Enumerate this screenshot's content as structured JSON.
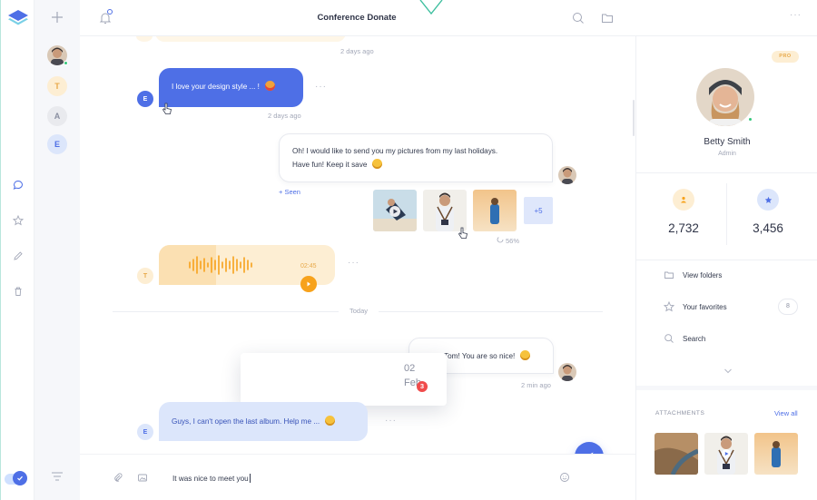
{
  "header": {
    "title": "Conference Donate"
  },
  "rail": {
    "items": [
      "layers-logo-icon",
      "chat-bubble-icon",
      "star-icon",
      "pencil-icon",
      "trash-icon",
      "toggle-switch"
    ]
  },
  "contacts": [
    {
      "initial": "",
      "kind": "photo"
    },
    {
      "initial": "T",
      "color": "#fdeed3",
      "text_color": "#e8a94a"
    },
    {
      "initial": "A",
      "color": "#e9eaee",
      "text_color": "#8a8fa0"
    },
    {
      "initial": "E",
      "color": "#dce6fb",
      "text_color": "#4e6fe6"
    }
  ],
  "messages": {
    "top_time": "2 days ago",
    "m1": {
      "initial": "E",
      "text": "I love your design style ... !",
      "time": "2 days ago"
    },
    "m2": {
      "line1": "Oh! I would like to send you my pictures from my last holidays.",
      "line2": "Have fun! Keep it save",
      "see_more": "+ Seen"
    },
    "gallery": {
      "more": "+5",
      "progress": "56%"
    },
    "audio": {
      "initial": "T",
      "duration": "02:45"
    },
    "divider": "Today",
    "m3": {
      "text": "Tom! You are so nice!",
      "time": "2 min ago"
    },
    "date_card": {
      "day": "02",
      "month": "Feb",
      "badge": "3"
    },
    "m4": {
      "initial": "E",
      "text": "Guys, I can't open the last album. Help me ..."
    }
  },
  "composer": {
    "value": "It was nice to meet you"
  },
  "profile": {
    "badge": "PRO",
    "name": "Betty Smith",
    "role": "Admin",
    "stat1": "2,732",
    "stat2": "3,456",
    "menu": {
      "folders": "View folders",
      "favorites": "Your favorites",
      "favorites_count": "8",
      "search": "Search"
    },
    "attachments_title": "ATTACHMENTS",
    "view_all": "View all"
  },
  "colors": {
    "accent": "#4e6fe6",
    "orange": "#f7a21b",
    "online": "#34c77b",
    "badge_red": "#f04b4b"
  }
}
